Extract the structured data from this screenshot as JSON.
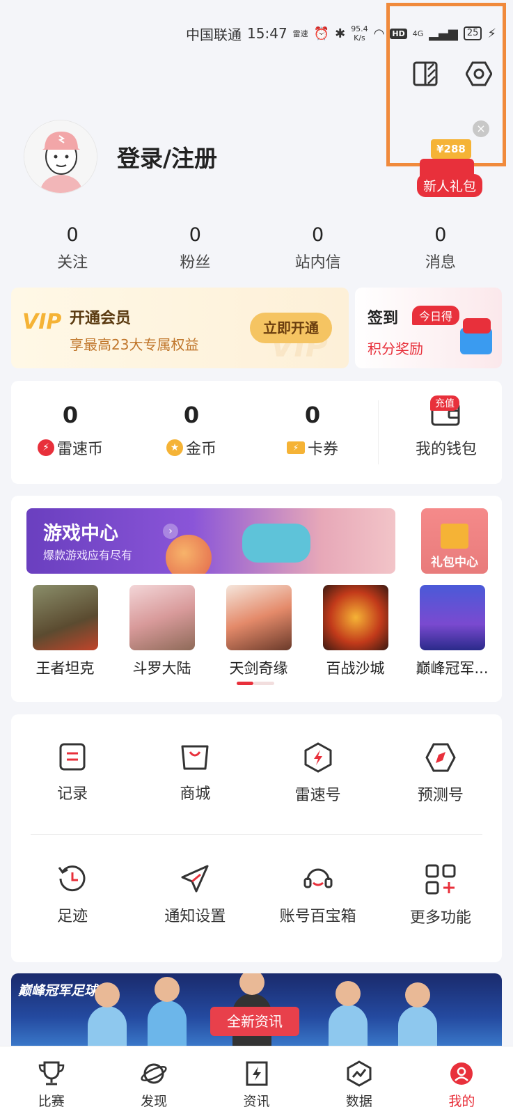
{
  "status_bar": {
    "carrier": "中国联通",
    "time": "15:47",
    "app_note": "雷速",
    "net_speed_value": "95.4",
    "net_speed_unit": "K/s",
    "network": "4G",
    "hd": "HD",
    "battery": "25"
  },
  "header": {
    "icons": [
      "theme-switch-icon",
      "settings-icon"
    ]
  },
  "profile": {
    "login_label": "登录/注册"
  },
  "gift": {
    "amount": "¥288",
    "label": "新人礼包",
    "close": "×"
  },
  "counts": [
    {
      "value": "0",
      "label": "关注"
    },
    {
      "value": "0",
      "label": "粉丝"
    },
    {
      "value": "0",
      "label": "站内信"
    },
    {
      "value": "0",
      "label": "消息"
    }
  ],
  "vip": {
    "badge": "VIP",
    "title": "开通会员",
    "subtitle": "享最高23大专属权益",
    "button": "立即开通",
    "watermark": "VIP"
  },
  "signin": {
    "title": "签到",
    "today_badge": "今日得",
    "subtitle": "积分奖励"
  },
  "wallet": {
    "items": [
      {
        "value": "0",
        "label": "雷速币",
        "icon": "lightning-coin-icon",
        "color": "#e8303b"
      },
      {
        "value": "0",
        "label": "金币",
        "icon": "gold-coin-icon",
        "color": "#f5b336"
      },
      {
        "value": "0",
        "label": "卡券",
        "icon": "coupon-icon",
        "color": "#f5b336"
      }
    ],
    "mine_label": "我的钱包",
    "recharge_badge": "充值"
  },
  "game_center": {
    "title": "游戏中心",
    "subtitle": "爆款游戏应有尽有",
    "gift_center": "礼包中心",
    "games": [
      {
        "name": "王者坦克"
      },
      {
        "name": "斗罗大陆"
      },
      {
        "name": "天剑奇缘"
      },
      {
        "name": "百战沙城"
      },
      {
        "name": "巅峰冠军..."
      }
    ]
  },
  "functions": {
    "row1": [
      {
        "label": "记录",
        "icon": "record-icon"
      },
      {
        "label": "商城",
        "icon": "shopping-bag-icon"
      },
      {
        "label": "雷速号",
        "icon": "lightning-hexagon-icon"
      },
      {
        "label": "预测号",
        "icon": "compass-icon"
      }
    ],
    "row2": [
      {
        "label": "足迹",
        "icon": "history-icon"
      },
      {
        "label": "通知设置",
        "icon": "send-icon"
      },
      {
        "label": "账号百宝箱",
        "icon": "headset-icon"
      },
      {
        "label": "更多功能",
        "icon": "more-grid-icon"
      }
    ]
  },
  "news_banner": {
    "logo": "巅峰冠军足球",
    "tag": "全新资讯"
  },
  "tabbar": [
    {
      "label": "比赛",
      "icon": "trophy-icon",
      "active": false
    },
    {
      "label": "发现",
      "icon": "planet-icon",
      "active": false
    },
    {
      "label": "资讯",
      "icon": "news-icon",
      "active": false
    },
    {
      "label": "数据",
      "icon": "data-icon",
      "active": false
    },
    {
      "label": "我的",
      "icon": "profile-icon",
      "active": true
    }
  ],
  "colors": {
    "accent": "#e8303b",
    "gold": "#f5b336",
    "highlight": "#f08a3c",
    "background": "#f4f5f9"
  }
}
